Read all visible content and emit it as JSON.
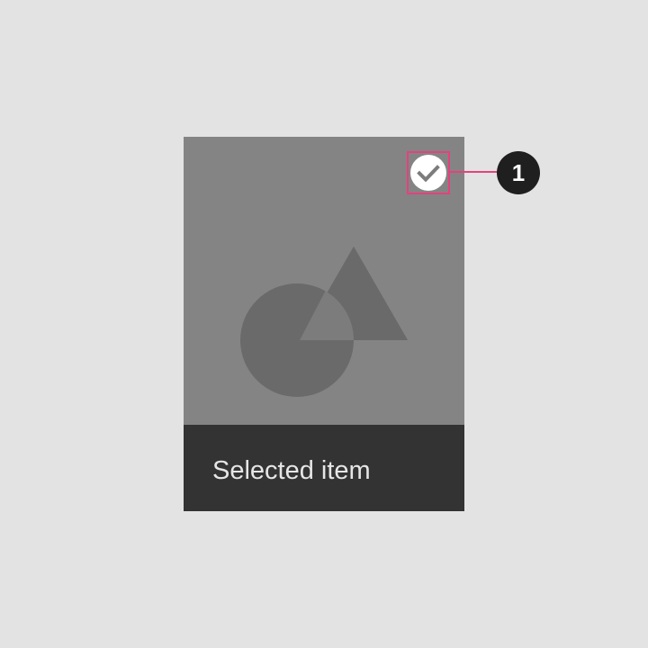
{
  "card": {
    "caption": "Selected item",
    "selected": true,
    "check_icon": "check-circle-icon",
    "media_icon": "image-placeholder-icon"
  },
  "callout": {
    "number": "1",
    "color": "#e5417e"
  },
  "colors": {
    "background": "#e3e3e3",
    "media": "#848484",
    "caption_bar": "#333333",
    "caption_text": "#e6e6e6",
    "badge": "#1f1f1f"
  }
}
